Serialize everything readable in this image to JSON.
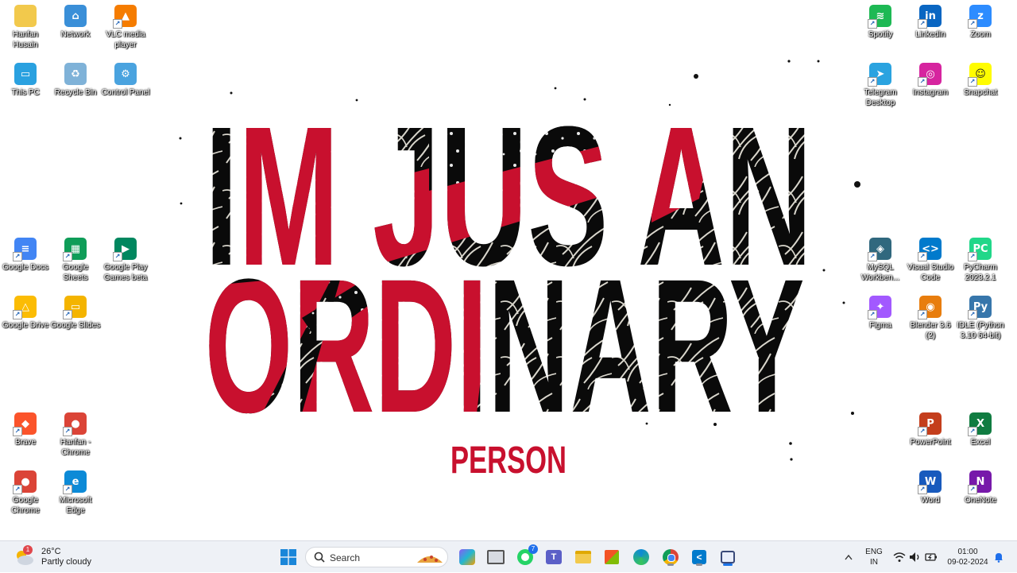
{
  "desktop": {
    "left_icons": [
      {
        "label": "Hanfan Husain",
        "icon": "folder-icon",
        "color": "#f2c94c"
      },
      {
        "label": "Network",
        "icon": "network-icon",
        "color": "#3a8fd8"
      },
      {
        "label": "VLC media player",
        "icon": "vlc-icon",
        "color": "#f57c00"
      },
      {
        "label": "This PC",
        "icon": "monitor-icon",
        "color": "#2aa1e0"
      },
      {
        "label": "Recycle Bin",
        "icon": "recycle-bin-icon",
        "color": "#7fb2d8"
      },
      {
        "label": "Control Panel",
        "icon": "control-panel-icon",
        "color": "#4aa3df"
      },
      {
        "label": "Google Docs",
        "icon": "google-docs-icon",
        "color": "#4285f4"
      },
      {
        "label": "Google Sheets",
        "icon": "google-sheets-icon",
        "color": "#0f9d58"
      },
      {
        "label": "Google Play Games beta",
        "icon": "google-play-games-icon",
        "color": "#01875f"
      },
      {
        "label": "Google Drive",
        "icon": "google-drive-icon",
        "color": "#fbbc04"
      },
      {
        "label": "Google Slides",
        "icon": "google-slides-icon",
        "color": "#f4b400"
      },
      {
        "label": "Brave",
        "icon": "brave-icon",
        "color": "#fb542b"
      },
      {
        "label": "Hanfan - Chrome",
        "icon": "chrome-profile-icon",
        "color": "#db4437"
      },
      {
        "label": "Google Chrome",
        "icon": "chrome-icon",
        "color": "#db4437"
      },
      {
        "label": "Microsoft Edge",
        "icon": "edge-icon",
        "color": "#0c8ad7"
      }
    ],
    "right_icons": [
      {
        "label": "Spotify",
        "icon": "spotify-icon",
        "color": "#1db954"
      },
      {
        "label": "LinkedIn",
        "icon": "linkedin-icon",
        "color": "#0a66c2"
      },
      {
        "label": "Zoom",
        "icon": "zoom-icon",
        "color": "#2d8cff"
      },
      {
        "label": "Telegram Desktop",
        "icon": "telegram-icon",
        "color": "#2aa3e0"
      },
      {
        "label": "Instagram",
        "icon": "instagram-icon",
        "color": "#d6249f"
      },
      {
        "label": "Snapchat",
        "icon": "snapchat-icon",
        "color": "#fffc00"
      },
      {
        "label": "MySQL Workben...",
        "icon": "mysql-workbench-icon",
        "color": "#30687e"
      },
      {
        "label": "Visual Studio Code",
        "icon": "vscode-icon",
        "color": "#007acc"
      },
      {
        "label": "PyCharm 2023.2.1",
        "icon": "pycharm-icon",
        "color": "#21d789"
      },
      {
        "label": "Figma",
        "icon": "figma-icon",
        "color": "#a259ff"
      },
      {
        "label": "Blender 3.6 (2)",
        "icon": "blender-icon",
        "color": "#e87d0d"
      },
      {
        "label": "IDLE (Python 3.10 64-bit)",
        "icon": "python-idle-icon",
        "color": "#3776ab"
      },
      {
        "label": "PowerPoint",
        "icon": "powerpoint-icon",
        "color": "#c43e1c"
      },
      {
        "label": "Excel",
        "icon": "excel-icon",
        "color": "#107c41"
      },
      {
        "label": "Word",
        "icon": "word-icon",
        "color": "#185abd"
      },
      {
        "label": "OneNote",
        "icon": "onenote-icon",
        "color": "#7719aa"
      }
    ]
  },
  "wallpaper": {
    "line1": "IM JUS AN",
    "line2": "ORDINARY",
    "line3": "PERSON",
    "red": "#c8102e",
    "black": "#0a0a0a"
  },
  "taskbar": {
    "weather": {
      "temp": "26°C",
      "condition": "Partly cloudy",
      "badge": "1"
    },
    "search_label": "Search",
    "whatsapp_badge": "7",
    "tray": {
      "lang_line1": "ENG",
      "lang_line2": "IN",
      "time": "01:00",
      "date": "09-02-2024"
    }
  }
}
